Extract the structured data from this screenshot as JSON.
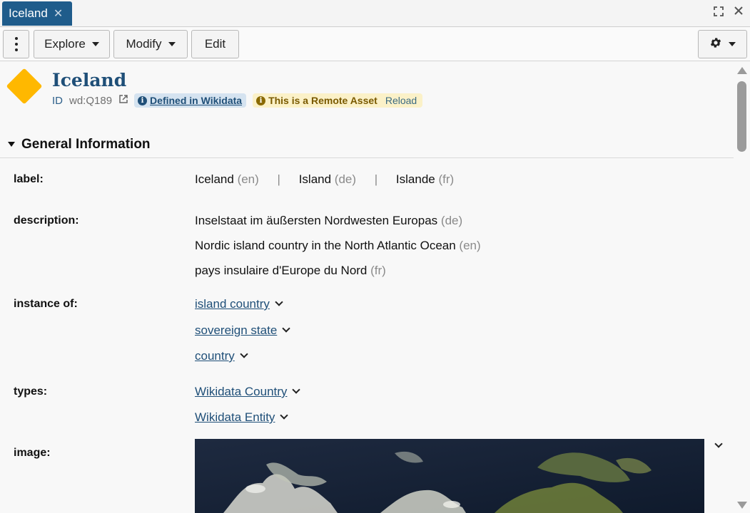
{
  "tab": {
    "title": "Iceland"
  },
  "toolbar": {
    "explore_label": "Explore",
    "modify_label": "Modify",
    "edit_label": "Edit"
  },
  "entity": {
    "title": "Iceland",
    "id_label": "ID",
    "id_value": "wd:Q189",
    "defined_badge": "Defined in Wikidata",
    "remote_badge": "This is a Remote Asset",
    "reload_label": "Reload"
  },
  "section": {
    "title": "General Information",
    "label": {
      "key": "label:",
      "values": [
        {
          "text": "Iceland",
          "lang": "(en)"
        },
        {
          "text": "Island",
          "lang": "(de)"
        },
        {
          "text": "Islande",
          "lang": "(fr)"
        }
      ],
      "separator": "|"
    },
    "description": {
      "key": "description:",
      "values": [
        {
          "text": "Inselstaat im äußersten Nordwesten Europas",
          "lang": "(de)"
        },
        {
          "text": "Nordic island country in the North Atlantic Ocean",
          "lang": "(en)"
        },
        {
          "text": "pays insulaire d'Europe du Nord",
          "lang": "(fr)"
        }
      ]
    },
    "instance_of": {
      "key": "instance of:",
      "values": [
        "island country",
        "sovereign state",
        "country"
      ]
    },
    "types": {
      "key": "types:",
      "values": [
        "Wikidata Country",
        "Wikidata Entity"
      ]
    },
    "image": {
      "key": "image:"
    }
  },
  "colors": {
    "tab_bg": "#1f5c8b",
    "title": "#1f4f78",
    "diamond": "#ffb800",
    "wd_badge": "#d5e3f0",
    "remote_badge": "#fbf1c8"
  },
  "icons": [
    "kebab-menu-icon",
    "gear-icon",
    "external-link-icon",
    "info-icon",
    "maximize-icon",
    "close-icon",
    "chevron-down-icon",
    "entity-diamond-icon"
  ]
}
